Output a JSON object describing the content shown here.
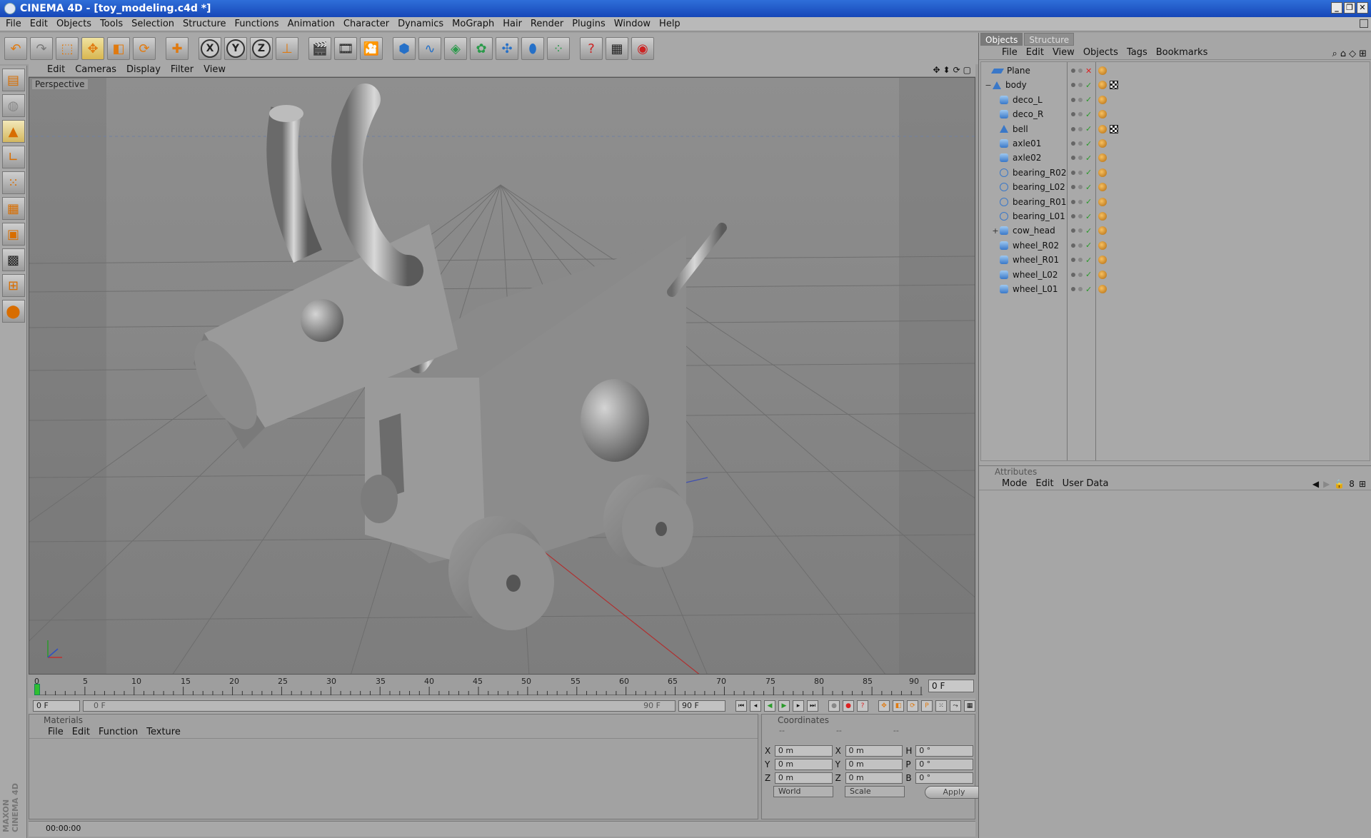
{
  "window": {
    "title": "CINEMA 4D - [toy_modeling.c4d *]",
    "buttons": [
      "_",
      "❐",
      "✕"
    ]
  },
  "menubar": {
    "items": [
      "File",
      "Edit",
      "Objects",
      "Tools",
      "Selection",
      "Structure",
      "Functions",
      "Animation",
      "Character",
      "Dynamics",
      "MoGraph",
      "Hair",
      "Render",
      "Plugins",
      "Window",
      "Help"
    ]
  },
  "toolbar": {
    "icons": [
      "undo-icon",
      "redo-icon",
      "live-selection-icon",
      "move-icon",
      "scale-icon",
      "rotate-icon",
      "add-icon",
      "x-axis-icon",
      "y-axis-icon",
      "z-axis-icon",
      "coordinate-system-icon",
      "render-view-icon",
      "render-picture-viewer-icon",
      "render-settings-icon",
      "cube-icon",
      "spline-icon",
      "nurbs-icon",
      "array-icon",
      "deformer-icon",
      "scene-icon",
      "particle-icon",
      "help-icon",
      "timeline-icon",
      "render-globe-icon"
    ],
    "axis_labels": [
      "X",
      "Y",
      "Z"
    ]
  },
  "left_tools": {
    "icons": [
      "layout-icon",
      "texture-icon",
      "model-icon",
      "axis-icon",
      "points-icon",
      "edges-icon",
      "polygons-icon",
      "texture-mode-icon",
      "workplane-icon",
      "paint-icon"
    ],
    "brand": "MAXON CINEMA 4D"
  },
  "viewport": {
    "menu": [
      "Edit",
      "Cameras",
      "Display",
      "Filter",
      "View"
    ],
    "label": "Perspective",
    "nav_icons": [
      "✥",
      "⬍",
      "⟳",
      "▢"
    ]
  },
  "timeline": {
    "ticks": [
      "0",
      "5",
      "10",
      "15",
      "20",
      "25",
      "30",
      "35",
      "40",
      "45",
      "50",
      "55",
      "60",
      "65",
      "70",
      "75",
      "80",
      "85",
      "90"
    ],
    "current_frame": "0 F",
    "start_field": "0 F",
    "range_start": "0 F",
    "range_end": "90 F",
    "end_field": "90 F"
  },
  "materials": {
    "title": "Materials",
    "menu": [
      "File",
      "Edit",
      "Function",
      "Texture"
    ]
  },
  "coordinates": {
    "title": "Coordinates",
    "dashes": [
      "--",
      "--",
      "--"
    ],
    "rows": [
      {
        "a": "X",
        "av": "0 m",
        "b": "X",
        "bv": "0 m",
        "c": "H",
        "cv": "0 °"
      },
      {
        "a": "Y",
        "av": "0 m",
        "b": "Y",
        "bv": "0 m",
        "c": "P",
        "cv": "0 °"
      },
      {
        "a": "Z",
        "av": "0 m",
        "b": "Z",
        "bv": "0 m",
        "c": "B",
        "cv": "0 °"
      }
    ],
    "space_dropdown": "World",
    "mode_dropdown": "Scale",
    "apply_label": "Apply"
  },
  "status": {
    "time": "00:00:00"
  },
  "object_manager": {
    "tabs": [
      "Objects",
      "Structure"
    ],
    "menu": [
      "File",
      "Edit",
      "View",
      "Objects",
      "Tags",
      "Bookmarks"
    ],
    "objects": [
      {
        "name": "Plane",
        "icon": "plane",
        "expander": "",
        "indent": 0,
        "tex": false,
        "xmark": true
      },
      {
        "name": "body",
        "icon": "tri",
        "expander": "−",
        "indent": 0,
        "tex": true,
        "xmark": false
      },
      {
        "name": "deco_L",
        "icon": "cyl",
        "expander": "",
        "indent": 1,
        "tex": false,
        "xmark": false
      },
      {
        "name": "deco_R",
        "icon": "cyl",
        "expander": "",
        "indent": 1,
        "tex": false,
        "xmark": false
      },
      {
        "name": "bell",
        "icon": "tri",
        "expander": "",
        "indent": 1,
        "tex": true,
        "xmark": false
      },
      {
        "name": "axle01",
        "icon": "cyl",
        "expander": "",
        "indent": 1,
        "tex": false,
        "xmark": false
      },
      {
        "name": "axle02",
        "icon": "cyl",
        "expander": "",
        "indent": 1,
        "tex": false,
        "xmark": false
      },
      {
        "name": "bearing_R02",
        "icon": "null",
        "expander": "",
        "indent": 1,
        "tex": false,
        "xmark": false
      },
      {
        "name": "bearing_L02",
        "icon": "null",
        "expander": "",
        "indent": 1,
        "tex": false,
        "xmark": false
      },
      {
        "name": "bearing_R01",
        "icon": "null",
        "expander": "",
        "indent": 1,
        "tex": false,
        "xmark": false
      },
      {
        "name": "bearing_L01",
        "icon": "null",
        "expander": "",
        "indent": 1,
        "tex": false,
        "xmark": false
      },
      {
        "name": "cow_head",
        "icon": "cyl",
        "expander": "+",
        "indent": 1,
        "tex": false,
        "xmark": false
      },
      {
        "name": "wheel_R02",
        "icon": "cyl",
        "expander": "",
        "indent": 1,
        "tex": false,
        "xmark": false
      },
      {
        "name": "wheel_R01",
        "icon": "cyl",
        "expander": "",
        "indent": 1,
        "tex": false,
        "xmark": false
      },
      {
        "name": "wheel_L02",
        "icon": "cyl",
        "expander": "",
        "indent": 1,
        "tex": false,
        "xmark": false
      },
      {
        "name": "wheel_L01",
        "icon": "cyl",
        "expander": "",
        "indent": 1,
        "tex": false,
        "xmark": false
      }
    ]
  },
  "attributes": {
    "title": "Attributes",
    "menu": [
      "Mode",
      "Edit",
      "User Data"
    ]
  }
}
